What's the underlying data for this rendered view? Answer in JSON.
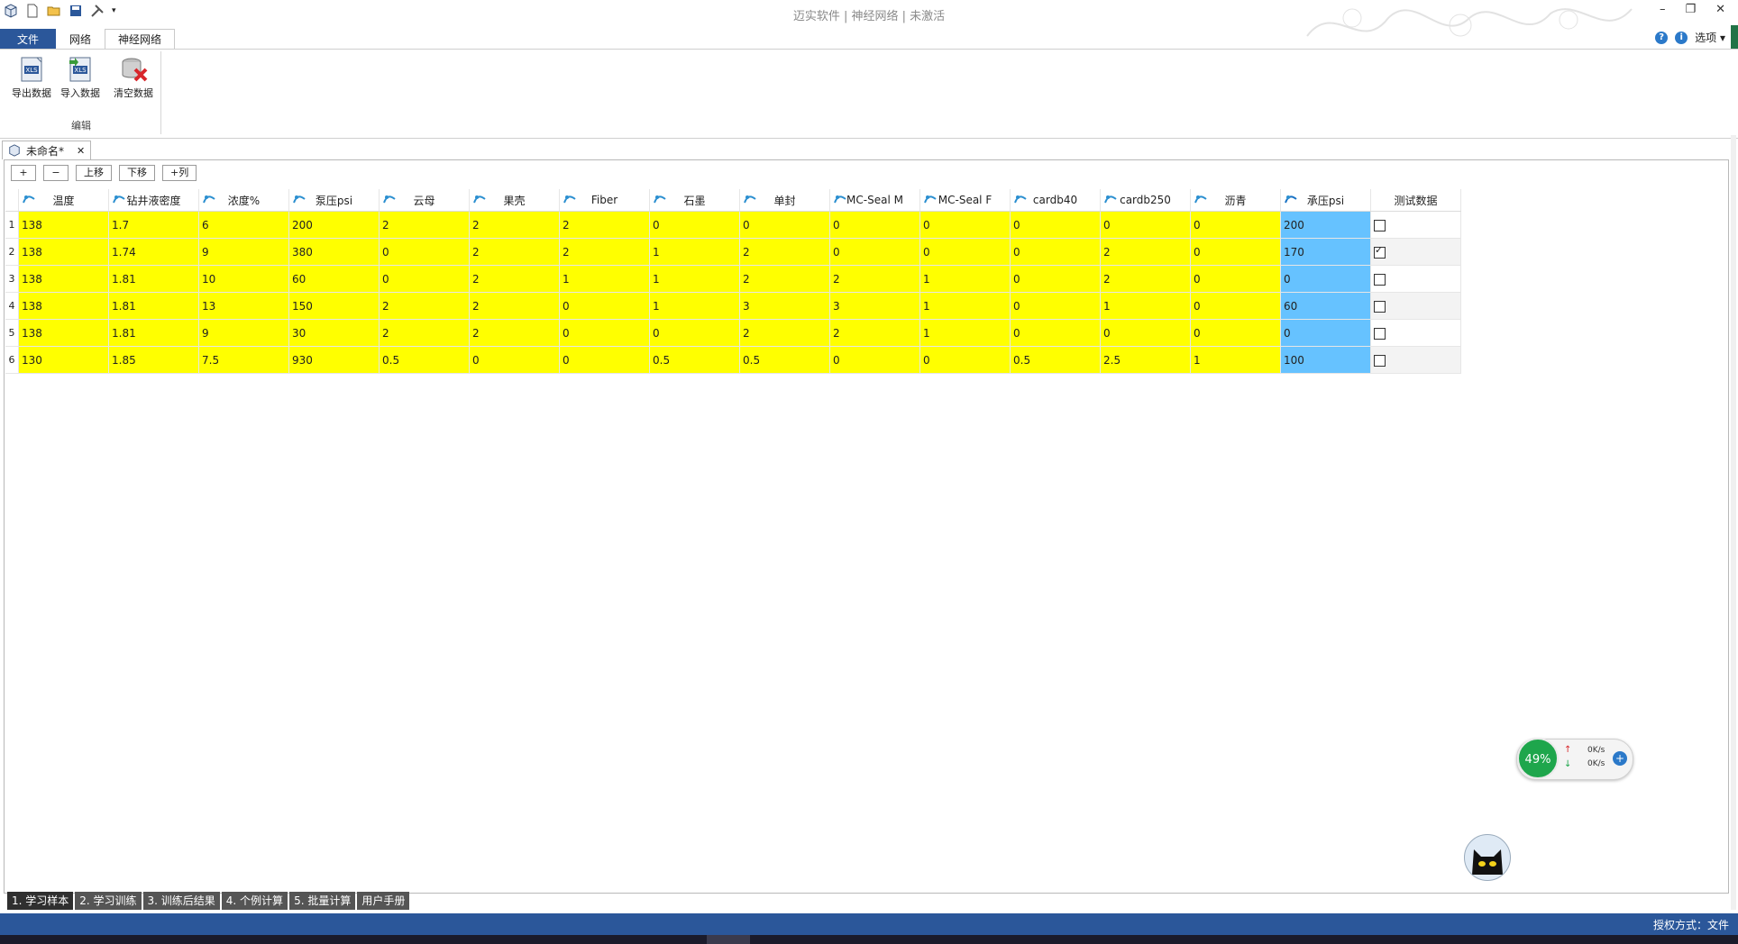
{
  "title": "迈实软件 | 神经网络 | 未激活",
  "menu_tabs": [
    "文件",
    "网络",
    "神经网络"
  ],
  "ribbon_right": {
    "options_label": "选项 ▾"
  },
  "ribbon": {
    "buttons": [
      {
        "label": "导出数据",
        "icon": "excel-export-icon"
      },
      {
        "label": "导入数据",
        "icon": "excel-import-icon"
      },
      {
        "label": "清空数据",
        "icon": "clear-data-icon"
      }
    ],
    "group_label": "编辑"
  },
  "document_tab": {
    "label": "未命名*"
  },
  "toolbar": {
    "add": "+",
    "remove": "−",
    "up": "上移",
    "down": "下移",
    "add_col": "+列"
  },
  "columns": [
    "温度",
    "钻井液密度",
    "浓度%",
    "泵压psi",
    "云母",
    "果壳",
    "Fiber",
    "石墨",
    "单封",
    "MC-Seal M",
    "MC-Seal F",
    "cardb40",
    "cardb250",
    "沥青",
    "承压psi",
    "测试数据"
  ],
  "rows": [
    {
      "n": "1",
      "cells": [
        "138",
        "1.7",
        "6",
        "200",
        "2",
        "2",
        "2",
        "0",
        "0",
        "0",
        "0",
        "0",
        "0",
        "0",
        "200"
      ],
      "test": false
    },
    {
      "n": "2",
      "cells": [
        "138",
        "1.74",
        "9",
        "380",
        "0",
        "2",
        "2",
        "1",
        "2",
        "0",
        "0",
        "0",
        "2",
        "0",
        "170"
      ],
      "test": true
    },
    {
      "n": "3",
      "cells": [
        "138",
        "1.81",
        "10",
        "60",
        "0",
        "2",
        "1",
        "1",
        "2",
        "2",
        "1",
        "0",
        "2",
        "0",
        "0"
      ],
      "test": false
    },
    {
      "n": "4",
      "cells": [
        "138",
        "1.81",
        "13",
        "150",
        "2",
        "2",
        "0",
        "1",
        "3",
        "3",
        "1",
        "0",
        "1",
        "0",
        "60"
      ],
      "test": false
    },
    {
      "n": "5",
      "cells": [
        "138",
        "1.81",
        "9",
        "30",
        "2",
        "2",
        "0",
        "0",
        "2",
        "2",
        "1",
        "0",
        "0",
        "0",
        "0"
      ],
      "test": false
    },
    {
      "n": "6",
      "cells": [
        "130",
        "1.85",
        "7.5",
        "930",
        "0.5",
        "0",
        "0",
        "0.5",
        "0.5",
        "0",
        "0",
        "0.5",
        "2.5",
        "1",
        "100"
      ],
      "test": false
    }
  ],
  "bottom_tabs": [
    "1. 学习样本",
    "2. 学习训练",
    "3. 训练后结果",
    "4. 个例计算",
    "5. 批量计算",
    "用户手册"
  ],
  "network_widget": {
    "percent": "49%",
    "up": "0K/s",
    "down": "0K/s"
  },
  "status": {
    "license": "授权方式：文件"
  },
  "colors": {
    "input_cell": "#ffff00",
    "output_cell": "#66c2ff",
    "accent": "#2b579a"
  }
}
